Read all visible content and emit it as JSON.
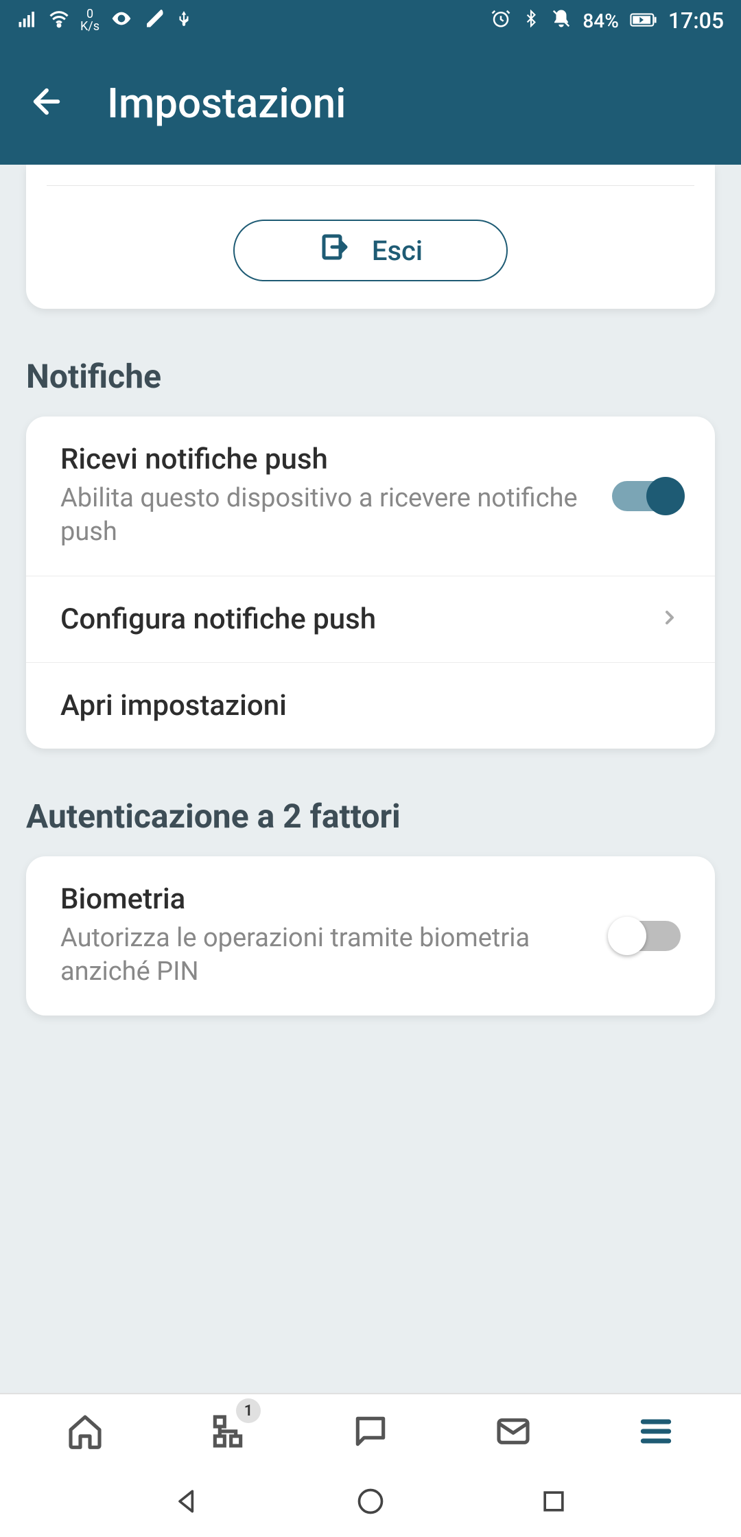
{
  "status": {
    "network_speed": "0",
    "network_unit": "K/s",
    "battery": "84%",
    "time": "17:05"
  },
  "header": {
    "title": "Impostazioni"
  },
  "logout_card": {
    "button_label": "Esci"
  },
  "sections": {
    "notifications": {
      "title": "Notifiche",
      "items": {
        "push_receive": {
          "title": "Ricevi notifiche push",
          "subtitle": "Abilita questo dispositivo a ricevere notifiche push",
          "enabled": true
        },
        "push_config": {
          "title": "Configura notifiche push"
        },
        "open_settings": {
          "title": "Apri impostazioni"
        }
      }
    },
    "two_factor": {
      "title": "Autenticazione a 2 fattori",
      "items": {
        "biometry": {
          "title": "Biometria",
          "subtitle": "Autorizza le operazioni tramite biometria anziché PIN",
          "enabled": false
        }
      }
    }
  },
  "bottom_nav": {
    "tree_badge": "1"
  }
}
